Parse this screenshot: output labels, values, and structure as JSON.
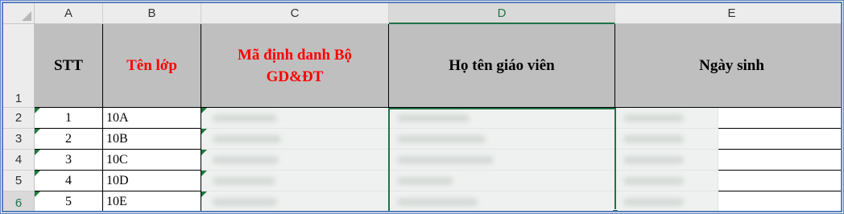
{
  "columns": [
    "A",
    "B",
    "C",
    "D",
    "E"
  ],
  "selected_column": "D",
  "rows": [
    "1",
    "2",
    "3",
    "4",
    "5",
    "6"
  ],
  "selected_row": "6",
  "table_header": {
    "stt": "STT",
    "class_name": "Tên lớp",
    "ministry_id": "Mã định danh Bộ GD&ĐT",
    "teacher_name": "Họ tên giáo viên",
    "birth_date": "Ngày sinh"
  },
  "table_rows": [
    {
      "stt": "1",
      "class_name": "10A"
    },
    {
      "stt": "2",
      "class_name": "10B"
    },
    {
      "stt": "3",
      "class_name": "10C"
    },
    {
      "stt": "4",
      "class_name": "10D"
    },
    {
      "stt": "5",
      "class_name": "10E"
    }
  ],
  "colors": {
    "header_fill": "#bfbfbf",
    "highlight_text": "#ff0000",
    "selection_accent": "#217346",
    "frame_border": "#5b7fbf"
  }
}
